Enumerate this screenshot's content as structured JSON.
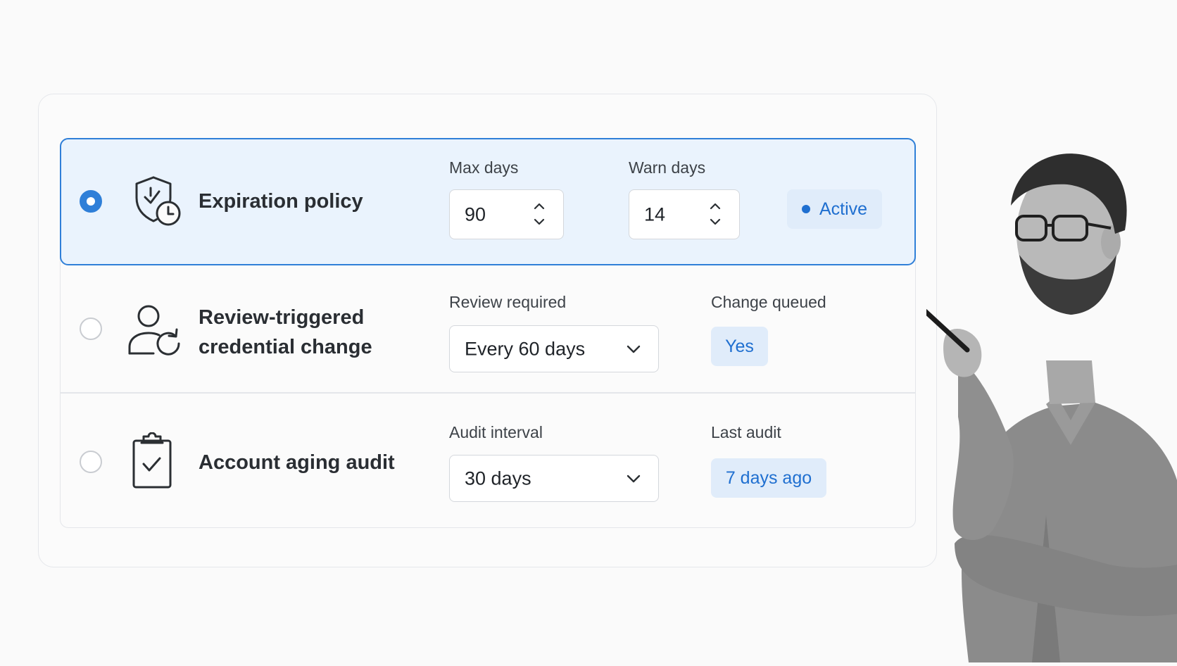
{
  "rows": [
    {
      "title": "Expiration policy",
      "selected": true,
      "icon": "shield-clock-icon",
      "fields": [
        {
          "label": "Max days",
          "value": "90"
        },
        {
          "label": "Warn days",
          "value": "14"
        }
      ],
      "status": {
        "text": "Active"
      }
    },
    {
      "title_line1": "Review-triggered",
      "title_line2": "credential change",
      "selected": false,
      "icon": "user-refresh-icon",
      "field": {
        "label": "Review required",
        "value": "Every 60 days"
      },
      "status": {
        "label": "Change queued",
        "text": "Yes"
      }
    },
    {
      "title": "Account aging audit",
      "selected": false,
      "icon": "clipboard-check-icon",
      "field": {
        "label": "Audit interval",
        "value": "30 days"
      },
      "status": {
        "label": "Last audit",
        "text": "7 days ago"
      }
    }
  ],
  "colors": {
    "accent": "#2f7fd8",
    "selected_bg": "#eaf3fd",
    "badge_bg": "#e0ecfa",
    "badge_text": "#1f6fd0"
  }
}
